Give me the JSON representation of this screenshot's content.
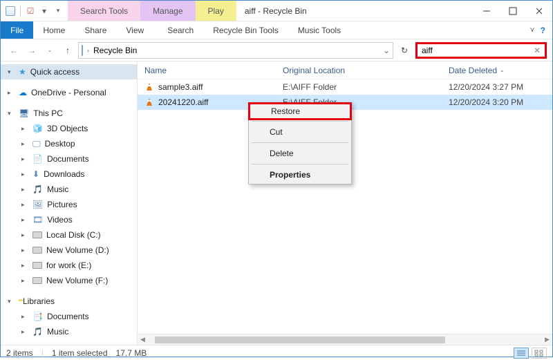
{
  "window": {
    "title": "aiff - Recycle Bin",
    "search_value": "aiff"
  },
  "context_tabs": {
    "search": {
      "top": "Search Tools",
      "bottom": "Search"
    },
    "manage": {
      "top": "Manage",
      "bottom": "Recycle Bin Tools"
    },
    "play": {
      "top": "Play",
      "bottom": "Music Tools"
    }
  },
  "ribbon": {
    "file": "File",
    "home": "Home",
    "share": "Share",
    "view": "View"
  },
  "address": {
    "location": "Recycle Bin"
  },
  "columns": {
    "name": "Name",
    "original_location": "Original Location",
    "date_deleted": "Date Deleted"
  },
  "files": [
    {
      "name": "sample3.aiff",
      "location": "E:\\AIFF Folder",
      "date": "12/20/2024 3:27 PM",
      "selected": false
    },
    {
      "name": "20241220.aiff",
      "location": "E:\\AIFF Folder",
      "date": "12/20/2024 3:20 PM",
      "selected": true
    }
  ],
  "context_menu": {
    "restore": "Restore",
    "cut": "Cut",
    "delete": "Delete",
    "properties": "Properties"
  },
  "sidebar": {
    "quick_access": "Quick access",
    "onedrive": "OneDrive - Personal",
    "this_pc": "This PC",
    "items_pc": [
      "3D Objects",
      "Desktop",
      "Documents",
      "Downloads",
      "Music",
      "Pictures",
      "Videos",
      "Local Disk (C:)",
      "New Volume (D:)",
      "for work (E:)",
      "New Volume (F:)"
    ],
    "libraries": "Libraries",
    "items_lib": [
      "Documents",
      "Music"
    ]
  },
  "status": {
    "count": "2 items",
    "selected": "1 item selected",
    "size": "17.7 MB"
  }
}
